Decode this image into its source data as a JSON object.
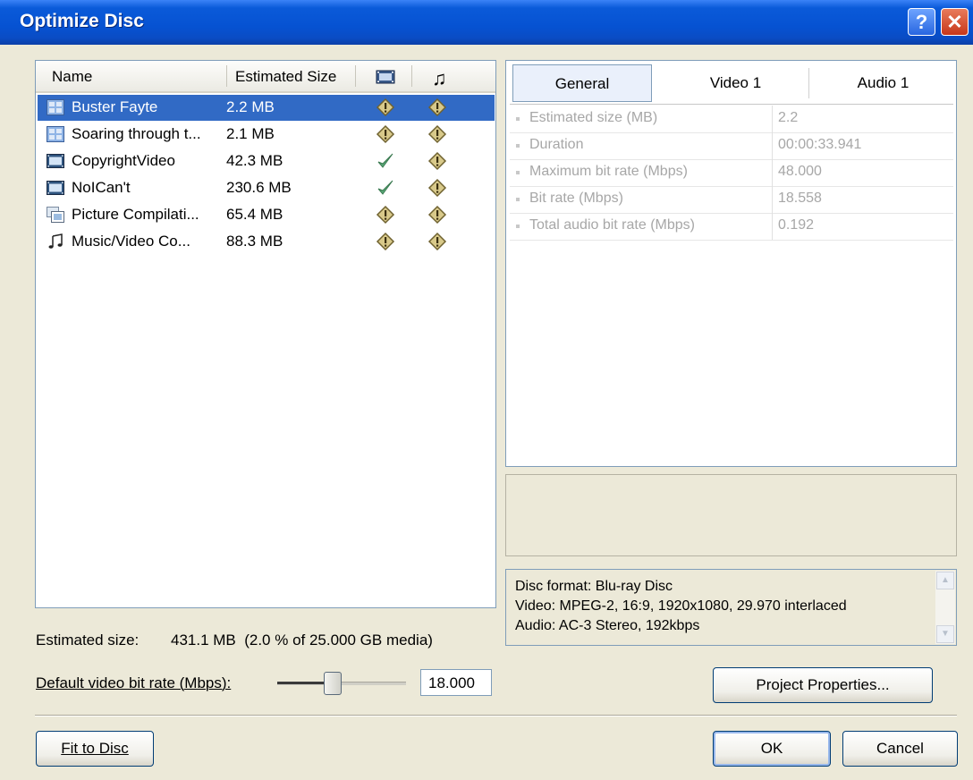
{
  "window": {
    "title": "Optimize Disc",
    "help_glyph": "?",
    "close_glyph": "✕"
  },
  "list": {
    "headers": {
      "name": "Name",
      "size": "Estimated Size"
    },
    "rows": [
      {
        "name": "Buster Fayte",
        "size": "2.2 MB",
        "icon": "video-title-icon",
        "video_status": "warning",
        "audio_status": "warning",
        "selected": true
      },
      {
        "name": "Soaring through t...",
        "size": "2.1 MB",
        "icon": "video-title-icon",
        "video_status": "warning",
        "audio_status": "warning"
      },
      {
        "name": "CopyrightVideo",
        "size": "42.3 MB",
        "icon": "film-icon",
        "video_status": "ok",
        "audio_status": "warning"
      },
      {
        "name": "NoICan't",
        "size": "230.6 MB",
        "icon": "film-icon",
        "video_status": "ok",
        "audio_status": "warning"
      },
      {
        "name": "Picture Compilati...",
        "size": "65.4 MB",
        "icon": "picture-compilation-icon",
        "video_status": "warning",
        "audio_status": "warning"
      },
      {
        "name": "Music/Video Co...",
        "size": "88.3 MB",
        "icon": "music-note-icon",
        "video_status": "warning",
        "audio_status": "warning"
      }
    ]
  },
  "tabs": [
    {
      "label": "General",
      "active": true
    },
    {
      "label": "Video 1"
    },
    {
      "label": "Audio 1"
    }
  ],
  "properties": [
    {
      "label": "Estimated size (MB)",
      "value": "2.2"
    },
    {
      "label": "Duration",
      "value": "00:00:33.941"
    },
    {
      "label": "Maximum bit rate (Mbps)",
      "value": "48.000"
    },
    {
      "label": "Bit rate (Mbps)",
      "value": "18.558"
    },
    {
      "label": "Total audio bit rate (Mbps)",
      "value": "0.192"
    }
  ],
  "disc_info": {
    "line1": "Disc format:  Blu-ray Disc",
    "line2": "Video:  MPEG-2, 16:9, 1920x1080, 29.970 interlaced",
    "line3": "Audio:  AC-3 Stereo, 192kbps"
  },
  "estimated": {
    "label": "Estimated size:",
    "value": "431.1 MB  (2.0 % of 25.000 GB media)"
  },
  "bitrate": {
    "label": "Default video bit rate (Mbps):",
    "value": "18.000",
    "slider_fraction": 0.44
  },
  "buttons": {
    "project_properties": "Project Properties...",
    "fit_to_disc": "Fit to Disc",
    "ok": "OK",
    "cancel": "Cancel"
  },
  "colors": {
    "title_bar": "#0a5ad9",
    "selection": "#316ac5",
    "ok_check": "#4a9e6a",
    "warning": "#8a7a3a"
  }
}
